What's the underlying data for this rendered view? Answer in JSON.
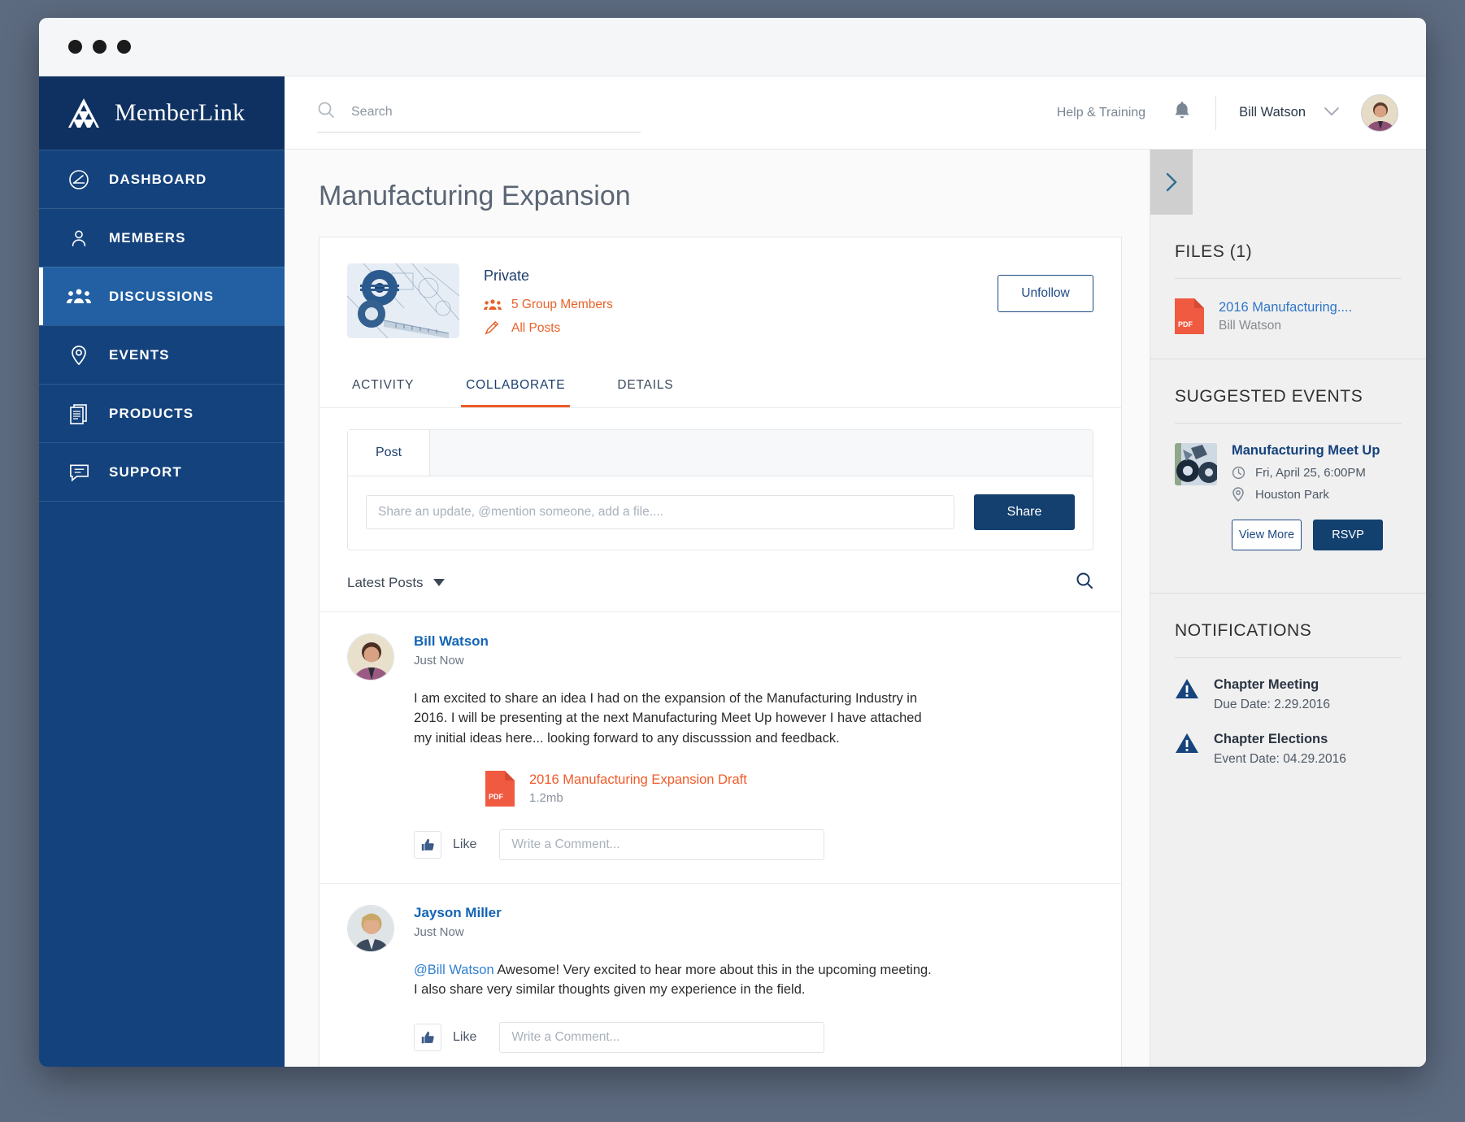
{
  "brand": {
    "name": "MemberLink"
  },
  "sidebar": {
    "items": [
      {
        "label": "DASHBOARD",
        "icon": "dashboard-gauge-icon",
        "active": false
      },
      {
        "label": "MEMBERS",
        "icon": "person-icon",
        "active": false
      },
      {
        "label": "DISCUSSIONS",
        "icon": "group-people-icon",
        "active": true
      },
      {
        "label": "EVENTS",
        "icon": "map-pin-icon",
        "active": false
      },
      {
        "label": "PRODUCTS",
        "icon": "documents-icon",
        "active": false
      },
      {
        "label": "SUPPORT",
        "icon": "chat-bubble-icon",
        "active": false
      }
    ]
  },
  "topbar": {
    "search_placeholder": "Search",
    "search_value": "",
    "help_label": "Help & Training",
    "user_name": "Bill Watson"
  },
  "page": {
    "title": "Manufacturing Expansion"
  },
  "group": {
    "privacy": "Private",
    "members_label": "5 Group Members",
    "posts_label": "All Posts",
    "unfollow_label": "Unfollow"
  },
  "tabs": [
    {
      "label": "ACTIVITY",
      "active": false
    },
    {
      "label": "COLLABORATE",
      "active": true
    },
    {
      "label": "DETAILS",
      "active": false
    }
  ],
  "composer": {
    "tab_label": "Post",
    "placeholder": "Share an update, @mention someone, add a file....",
    "value": "",
    "share_label": "Share"
  },
  "feed": {
    "sort_label": "Latest Posts",
    "posts": [
      {
        "author": "Bill Watson",
        "time": "Just Now",
        "text": "I am excited to share an idea I had on the expansion of the Manufacturing Industry in 2016. I will be presenting at the next Manufacturing Meet Up however I have attached my initial ideas here... looking forward to any discusssion and feedback.",
        "mention": "",
        "attachment": {
          "name": "2016 Manufacturing Expansion Draft",
          "size": "1.2mb",
          "type": "PDF"
        },
        "like_label": "Like",
        "comment_placeholder": "Write a Comment..."
      },
      {
        "author": "Jayson Miller",
        "time": "Just Now",
        "mention": "@Bill Watson",
        "text": " Awesome! Very excited to hear more about this in the upcoming meeting. I also share very similar thoughts given my experience in the field.",
        "attachment": null,
        "like_label": "Like",
        "comment_placeholder": "Write a Comment..."
      }
    ]
  },
  "rightpanel": {
    "files": {
      "title": "FILES (1)",
      "items": [
        {
          "name": "2016 Manufacturing....",
          "owner": "Bill Watson",
          "type": "PDF"
        }
      ]
    },
    "suggested_events": {
      "title": "SUGGESTED EVENTS",
      "items": [
        {
          "name": "Manufacturing Meet Up",
          "date": "Fri, April 25, 6:00PM",
          "location": "Houston Park",
          "view_more_label": "View More",
          "rsvp_label": "RSVP"
        }
      ]
    },
    "notifications": {
      "title": "NOTIFICATIONS",
      "items": [
        {
          "title": "Chapter Meeting",
          "sub": "Due Date: 2.29.2016"
        },
        {
          "title": "Chapter Elections",
          "sub": "Event Date: 04.29.2016"
        }
      ]
    }
  },
  "colors": {
    "sidebar_blue": "#14427d",
    "brand_blue": "#0e3161",
    "accent_orange": "#ec5b27",
    "link_blue": "#1464b4",
    "pdf_red": "#ef5b44"
  }
}
